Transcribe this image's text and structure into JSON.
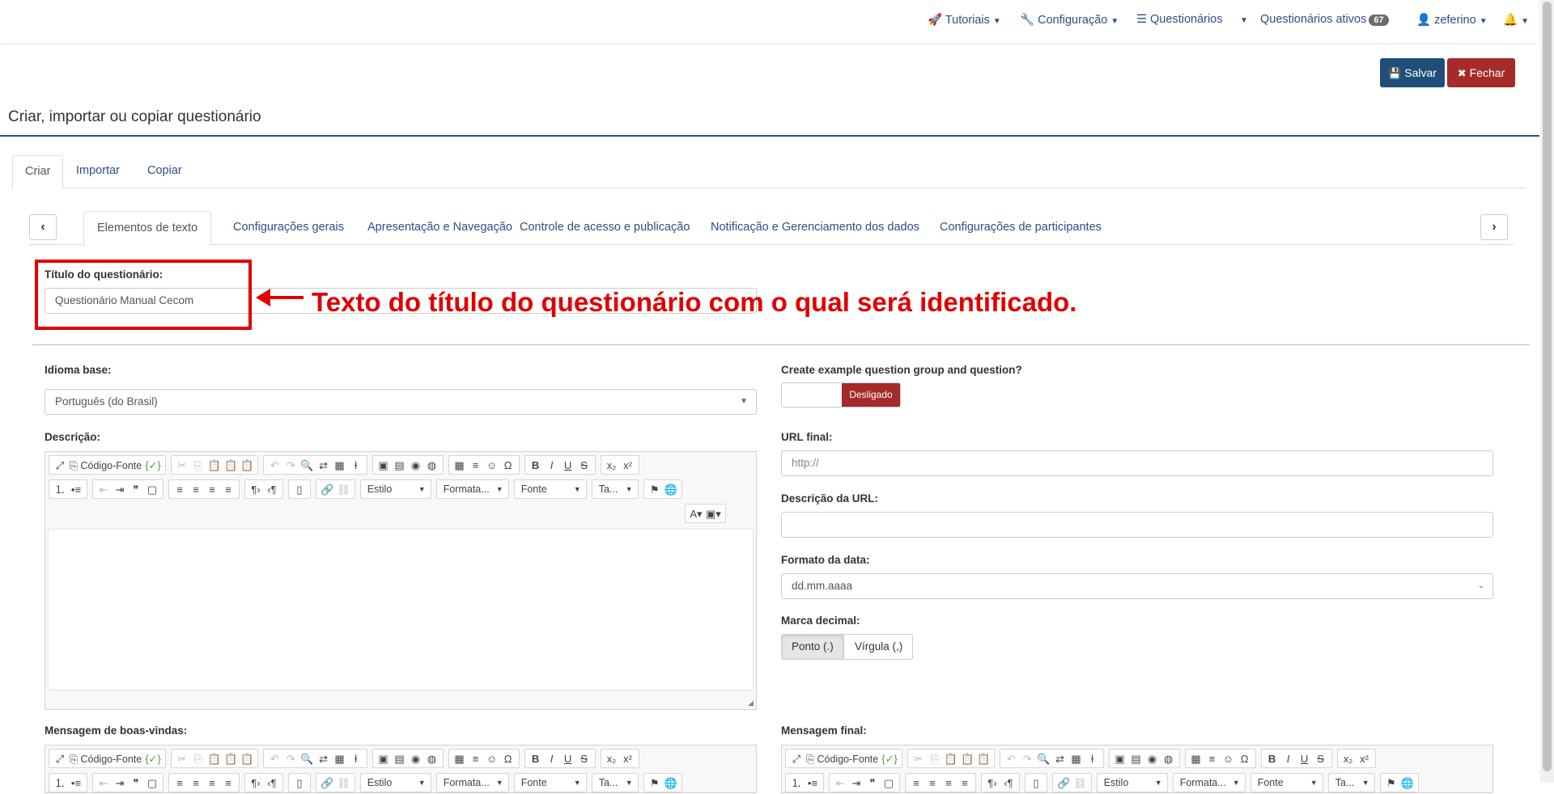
{
  "nav": {
    "items": [
      {
        "label": "Tutoriais",
        "icon": "rocket-icon"
      },
      {
        "label": "Configuração",
        "icon": "wrench-icon"
      },
      {
        "label": "Questionários",
        "icon": "list-icon"
      },
      {
        "label": "Questionários ativos",
        "badge": "67"
      },
      {
        "label": "zeferino",
        "icon": "user-icon"
      }
    ]
  },
  "actions": {
    "save": "Salvar",
    "close": "Fechar"
  },
  "page": {
    "title": "Criar, importar ou copiar questionário"
  },
  "tabs": [
    "Criar",
    "Importar",
    "Copiar"
  ],
  "subtabs": [
    "Elementos de texto",
    "Configurações gerais",
    "Apresentação e Navegação",
    "Controle de acesso e publicação",
    "Notificação e Gerenciamento dos dados",
    "Configurações de participantes"
  ],
  "form": {
    "title_label": "Título do questionário:",
    "title_value": "Questionário Manual Cecom",
    "base_lang_label": "Idioma base:",
    "base_lang_value": "Português (do Brasil)",
    "description_label": "Descrição:",
    "welcome_label": "Mensagem de boas-vindas:",
    "end_label": "Mensagem final:",
    "example_label": "Create example question group and question?",
    "example_toggle": "Desligado",
    "end_url_label": "URL final:",
    "end_url_placeholder": "http://",
    "url_desc_label": "Descrição da URL:",
    "date_format_label": "Formato da data:",
    "date_format_value": "dd.mm.aaaa",
    "decimal_label": "Marca decimal:",
    "decimal_options": [
      "Ponto (.)",
      "Vírgula (,)"
    ]
  },
  "editor": {
    "source_label": "Código-Fonte",
    "style_label": "Estilo",
    "format_label": "Formata...",
    "font_label": "Fonte",
    "size_label": "Ta..."
  },
  "annotation": {
    "text": "Texto do título do questionário com o qual será identificado."
  },
  "colors": {
    "primary": "#1f4e79",
    "danger": "#a52a2a",
    "annotation": "#e00000",
    "link": "#2d4e85"
  }
}
